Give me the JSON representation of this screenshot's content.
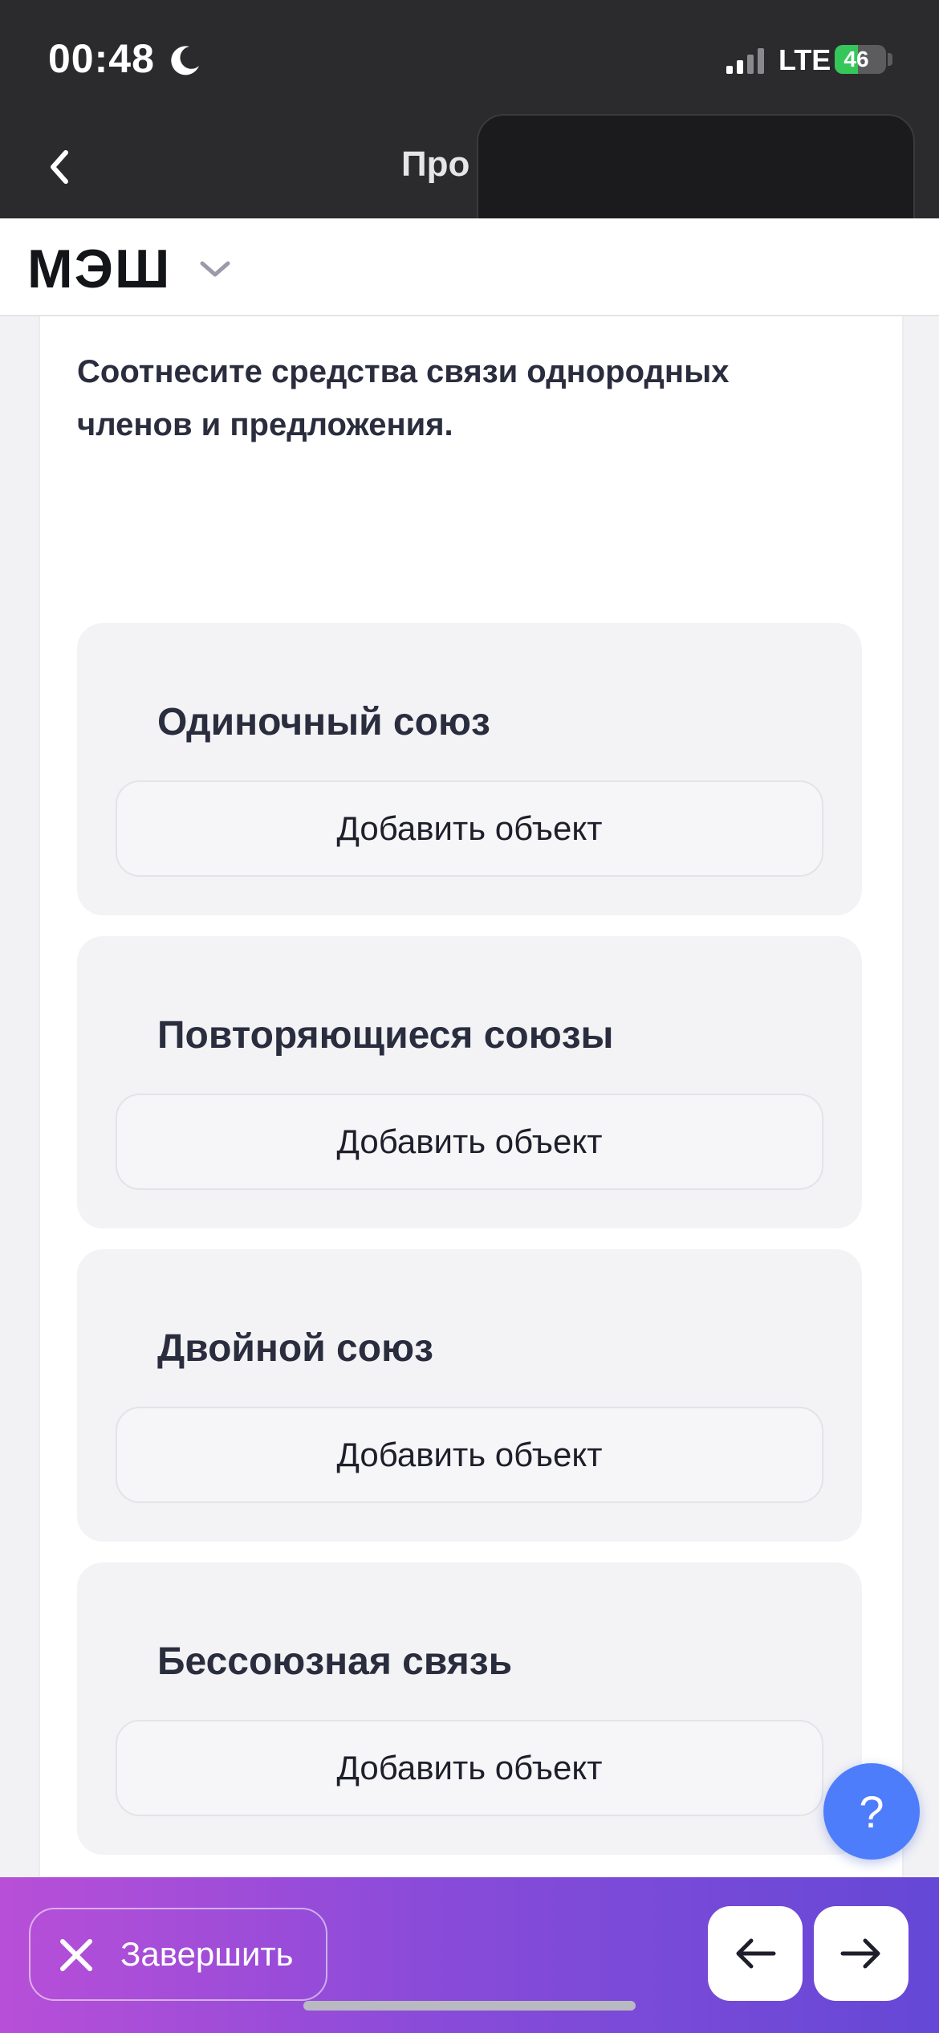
{
  "status_bar": {
    "time": "00:48",
    "network": "LTE",
    "battery_level": "46",
    "battery_fraction": 0.46,
    "icons": [
      "moon-icon",
      "signal-icon",
      "charging-icon"
    ]
  },
  "nav": {
    "title": "Про",
    "back_icon": "chevron-left-icon"
  },
  "brand": {
    "logo_text": "МЭШ",
    "menu_icon": "chevron-down-icon"
  },
  "question": {
    "text": "Соотнесите средства связи однородных членов и предложения."
  },
  "groups": [
    {
      "title": "Одиночный союз",
      "button": "Добавить объект"
    },
    {
      "title": "Повторяющиеся союзы",
      "button": "Добавить объект"
    },
    {
      "title": "Двойной союз",
      "button": "Добавить объект"
    },
    {
      "title": "Бессоюзная связь",
      "button": "Добавить объект"
    }
  ],
  "help": {
    "label": "?"
  },
  "bottom": {
    "finish_label": "Завершить",
    "prev_icon": "arrow-left-icon",
    "next_icon": "arrow-right-icon"
  },
  "colors": {
    "accent": "#4e7dfb",
    "bar_gradient_start": "#b84fd8",
    "bar_gradient_end": "#6548d6",
    "battery_green": "#35c759"
  }
}
